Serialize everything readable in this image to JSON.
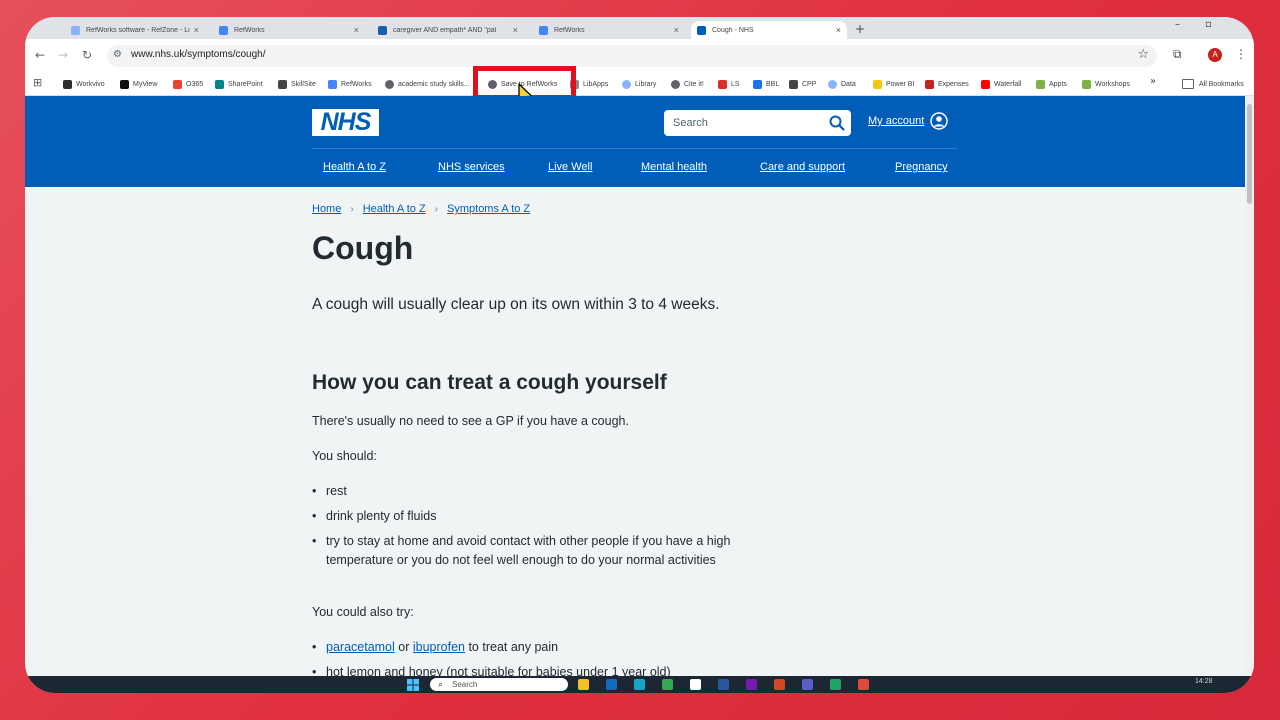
{
  "browser": {
    "tabs": [
      {
        "label": "RefWorks software - RefZone - Lib",
        "active": false,
        "color": "#8ab4f8"
      },
      {
        "label": "RefWorks",
        "active": false,
        "color": "#4285f4"
      },
      {
        "label": "caregiver AND empath* AND \"pal",
        "active": false,
        "color": "#1a5ea8"
      },
      {
        "label": "RefWorks",
        "active": false,
        "color": "#4285f4"
      },
      {
        "label": "Cough - NHS",
        "active": true,
        "color": "#005eb8"
      }
    ],
    "new_tab_glyph": "+",
    "url": "www.nhs.uk/symptoms/cough/",
    "profile_initial": "A",
    "bookmarks": [
      {
        "label": "Workvivo",
        "icon": "workvivo-icon",
        "color": "#2c2c2c"
      },
      {
        "label": "MyView",
        "icon": "myview-icon",
        "color": "#111111"
      },
      {
        "label": "O365",
        "icon": "o365-icon",
        "color": "#ea4335"
      },
      {
        "label": "SharePoint",
        "icon": "sharepoint-icon",
        "color": "#038387"
      },
      {
        "label": "SkillSite",
        "icon": "skillsite-icon",
        "color": "#444444"
      },
      {
        "label": "RefWorks",
        "icon": "refworks-icon",
        "color": "#4285f4"
      },
      {
        "label": "academic study skills...",
        "icon": "globe-icon",
        "color": "#5f6368"
      },
      {
        "label": "Save to RefWorks",
        "icon": "globe-icon",
        "color": "#5f6368"
      },
      {
        "label": "LibApps",
        "icon": "libapps-icon",
        "color": "#8a8a8a"
      },
      {
        "label": "Library",
        "icon": "cloud-icon",
        "color": "#8ab4f8"
      },
      {
        "label": "Cite it!",
        "icon": "globe-icon",
        "color": "#5f6368"
      },
      {
        "label": "LS",
        "icon": "ls-icon",
        "color": "#d93025"
      },
      {
        "label": "BBL",
        "icon": "bbl-icon",
        "color": "#1a73e8"
      },
      {
        "label": "CPP",
        "icon": "cpp-icon",
        "color": "#444444"
      },
      {
        "label": "Data",
        "icon": "cloud-icon",
        "color": "#8ab4f8"
      },
      {
        "label": "Power BI",
        "icon": "powerbi-icon",
        "color": "#f2c811"
      },
      {
        "label": "Expenses",
        "icon": "expenses-icon",
        "color": "#c5221f"
      },
      {
        "label": "Waterfall",
        "icon": "youtube-icon",
        "color": "#ff0000"
      },
      {
        "label": "Appts",
        "icon": "appts-icon",
        "color": "#7cb342"
      },
      {
        "label": "Workshops",
        "icon": "workshops-icon",
        "color": "#7cb342"
      }
    ],
    "more_glyph": "»",
    "all_bookmarks": "All Bookmarks"
  },
  "nhs": {
    "logo": "NHS",
    "search_placeholder": "Search",
    "account_label": "My account",
    "nav": [
      "Health A to Z",
      "NHS services",
      "Live Well",
      "Mental health",
      "Care and support",
      "Pregnancy"
    ]
  },
  "page": {
    "breadcrumb": [
      "Home",
      "Health A to Z",
      "Symptoms A to Z"
    ],
    "title": "Cough",
    "lede": "A cough will usually clear up on its own within 3 to 4 weeks.",
    "section_heading": "How you can treat a cough yourself",
    "no_need": "There's usually no need to see a GP if you have a cough.",
    "you_should": "You should:",
    "should_items": [
      "rest",
      "drink plenty of fluids",
      "try to stay at home and avoid contact with other people if you have a high temperature or you do not feel well enough to do your normal activities"
    ],
    "could_also": "You could also try:",
    "try_items": {
      "paracetamol": "paracetamol",
      "or": " or ",
      "ibuprofen": "ibuprofen",
      "pain_suffix": " to treat any pain",
      "lemon": "hot lemon and honey (not suitable for babies under 1 year old)"
    }
  },
  "taskbar": {
    "search_label": "Search",
    "clock": "14:28",
    "apps": [
      {
        "icon": "file-explorer-icon",
        "color": "#f4c025"
      },
      {
        "icon": "outlook-icon",
        "color": "#0f6cbd"
      },
      {
        "icon": "edge-icon",
        "color": "#16a4c9"
      },
      {
        "icon": "chrome-icon",
        "color": "#34a853"
      },
      {
        "icon": "document-icon",
        "color": "#ffffff"
      },
      {
        "icon": "word-icon",
        "color": "#2b579a"
      },
      {
        "icon": "onenote-icon",
        "color": "#7719aa"
      },
      {
        "icon": "powerpoint-icon",
        "color": "#d24726"
      },
      {
        "icon": "teams-icon",
        "color": "#5b5fc7"
      },
      {
        "icon": "green-app-icon",
        "color": "#21a366"
      },
      {
        "icon": "red-app-icon",
        "color": "#e3483c"
      }
    ]
  }
}
